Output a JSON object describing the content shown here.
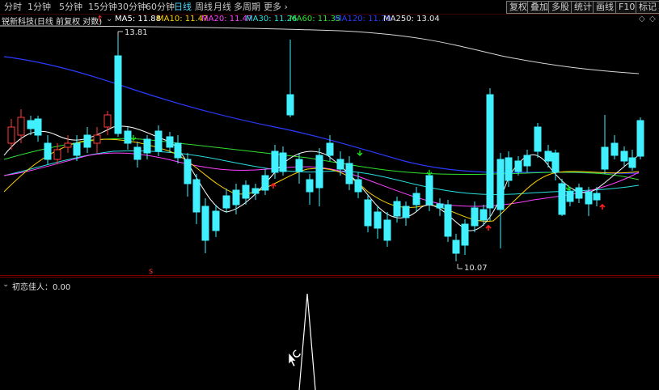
{
  "toolbar": {
    "tabs": [
      "分时",
      "1分钟",
      "5分钟",
      "15分钟",
      "30分钟",
      "60分钟",
      "日线",
      "周线",
      "月线",
      "多周期",
      "更多"
    ],
    "active_tab": "日线",
    "more_arrow": "›",
    "right_buttons": [
      "复权",
      "叠加",
      "多股",
      "统计",
      "画线",
      "F10",
      "标记"
    ]
  },
  "main": {
    "stock_title": "锐新科技(日线 前复权 对数)",
    "ma_legend": [
      {
        "label": "MA5: 11.88",
        "color": "#ffffff"
      },
      {
        "label": "MA10: 11.47",
        "color": "#ffd200"
      },
      {
        "label": "MA20: 11.47",
        "color": "#ff40ff"
      },
      {
        "label": "MA30: 11.26",
        "color": "#28e0e0"
      },
      {
        "label": "MA60: 11.35",
        "color": "#30e030"
      },
      {
        "label": "MA120: 11.79",
        "color": "#2a3cff"
      },
      {
        "label": "MA250: 13.04",
        "color": "#e8e8e8"
      }
    ],
    "high_label": "13.81",
    "low_label": "10.07",
    "marker_s": "s",
    "window_icons": [
      "◇",
      "◇"
    ]
  },
  "indicator": {
    "title": "初恋佳人：0.00"
  },
  "colors": {
    "up": "#ff3a3a",
    "down": "#40f0ff",
    "accent_tab": "#4fd8ff"
  },
  "icons": [
    "up-arrow-icon",
    "circle-chevron-icon",
    "diamond-icon",
    "mouse-pointer-icon",
    "loading-ring-icon"
  ]
}
